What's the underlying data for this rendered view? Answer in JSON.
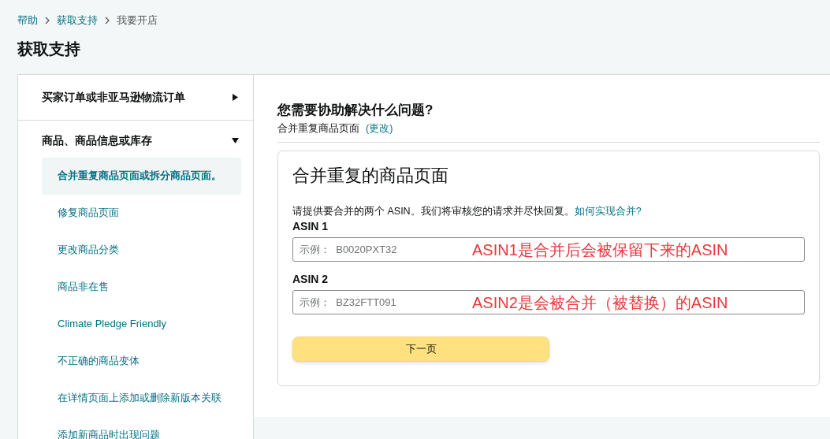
{
  "breadcrumb": [
    {
      "label": "帮助",
      "kind": "link"
    },
    {
      "label": "获取支持",
      "kind": "link"
    },
    {
      "label": "我要开店",
      "kind": "current"
    }
  ],
  "page_title": "获取支持",
  "sidebar": {
    "sections": [
      {
        "label": "买家订单或非亚马逊物流订单",
        "expanded": false
      },
      {
        "label": "商品、商品信息或库存",
        "expanded": true,
        "children": [
          {
            "label": "合并重复商品页面或拆分商品页面。",
            "selected": true
          },
          {
            "label": "修复商品页面",
            "selected": false
          },
          {
            "label": "更改商品分类",
            "selected": false
          },
          {
            "label": "商品非在售",
            "selected": false
          },
          {
            "label": "Climate Pledge Friendly",
            "selected": false
          },
          {
            "label": "不正确的商品变体",
            "selected": false
          },
          {
            "label": "在详情页面上添加或删除新版本关联",
            "selected": false
          },
          {
            "label": "添加新商品时出现问题",
            "selected": false
          }
        ]
      }
    ]
  },
  "question": {
    "heading": "您需要协助解决什么问题?",
    "selection": "合并重复商品页面",
    "change_link": "(更改)"
  },
  "form": {
    "title": "合并重复的商品页面",
    "intro": "请提供要合并的两个 ASIN。我们将审核您的请求并尽快回复。",
    "help_link": "如何实现合并?",
    "fields": [
      {
        "label": "ASIN 1",
        "placeholder": "示例：  B0020PXT32",
        "annotation": "ASIN1是合并后会被保留下来的ASIN"
      },
      {
        "label": "ASIN 2",
        "placeholder": "示例：  BZ32FTT091",
        "annotation": "ASIN2是会被合并（被替换）的ASIN"
      }
    ],
    "submit": "下一页"
  }
}
